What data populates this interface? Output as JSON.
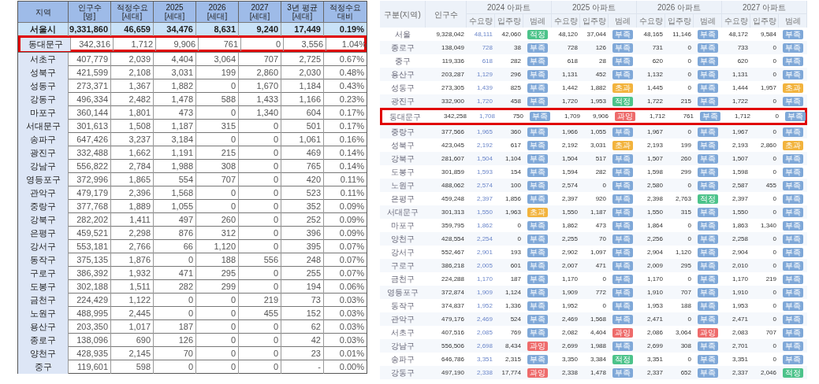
{
  "left_table": {
    "columns": [
      {
        "title": "지역"
      },
      {
        "title": "인구수",
        "unit": "[명]"
      },
      {
        "title": "적정수요",
        "unit": "[세대]"
      },
      {
        "title": "2025",
        "unit": "[세대]"
      },
      {
        "title": "2026",
        "unit": "[세대]"
      },
      {
        "title": "2027",
        "unit": "[세대]"
      },
      {
        "title": "3년 평균",
        "unit": "[세대]"
      },
      {
        "title": "적정수요",
        "unit": "대비"
      }
    ],
    "rows": [
      {
        "kind": "total",
        "highlighted": false,
        "cells": [
          "서울시",
          "9,331,860",
          "46,659",
          "34,476",
          "8,631",
          "9,240",
          "17,449",
          "0.19%"
        ]
      },
      {
        "kind": "district",
        "highlighted": true,
        "cells": [
          "동대문구",
          "342,316",
          "1,712",
          "9,906",
          "761",
          "0",
          "3,556",
          "1.04%"
        ]
      },
      {
        "kind": "district",
        "highlighted": false,
        "cells": [
          "서초구",
          "407,779",
          "2,039",
          "4,404",
          "3,064",
          "707",
          "2,725",
          "0.67%"
        ]
      },
      {
        "kind": "district",
        "highlighted": false,
        "cells": [
          "성북구",
          "421,599",
          "2,108",
          "3,031",
          "199",
          "2,860",
          "2,030",
          "0.48%"
        ]
      },
      {
        "kind": "district",
        "highlighted": false,
        "cells": [
          "성동구",
          "273,371",
          "1,367",
          "1,882",
          "0",
          "1,670",
          "1,184",
          "0.43%"
        ]
      },
      {
        "kind": "district",
        "highlighted": false,
        "cells": [
          "강동구",
          "496,334",
          "2,482",
          "1,478",
          "588",
          "1,433",
          "1,166",
          "0.23%"
        ]
      },
      {
        "kind": "district",
        "highlighted": false,
        "cells": [
          "마포구",
          "360,144",
          "1,801",
          "473",
          "0",
          "1,340",
          "604",
          "0.17%"
        ]
      },
      {
        "kind": "district",
        "highlighted": false,
        "cells": [
          "서대문구",
          "301,613",
          "1,508",
          "1,187",
          "315",
          "0",
          "501",
          "0.17%"
        ]
      },
      {
        "kind": "district",
        "highlighted": false,
        "cells": [
          "송파구",
          "647,426",
          "3,237",
          "3,184",
          "0",
          "0",
          "1,061",
          "0.16%"
        ]
      },
      {
        "kind": "district",
        "highlighted": false,
        "cells": [
          "광진구",
          "332,488",
          "1,662",
          "1,191",
          "215",
          "0",
          "469",
          "0.14%"
        ]
      },
      {
        "kind": "district",
        "highlighted": false,
        "cells": [
          "강남구",
          "556,822",
          "2,784",
          "1,988",
          "308",
          "0",
          "765",
          "0.14%"
        ]
      },
      {
        "kind": "district",
        "highlighted": false,
        "cells": [
          "영등포구",
          "372,996",
          "1,865",
          "554",
          "707",
          "0",
          "420",
          "0.11%"
        ]
      },
      {
        "kind": "district",
        "highlighted": false,
        "cells": [
          "관악구",
          "479,179",
          "2,396",
          "1,568",
          "0",
          "0",
          "523",
          "0.11%"
        ]
      },
      {
        "kind": "district",
        "highlighted": false,
        "cells": [
          "중랑구",
          "377,768",
          "1,889",
          "1,055",
          "0",
          "0",
          "352",
          "0.09%"
        ]
      },
      {
        "kind": "district",
        "highlighted": false,
        "cells": [
          "강북구",
          "282,202",
          "1,411",
          "497",
          "260",
          "0",
          "252",
          "0.09%"
        ]
      },
      {
        "kind": "district",
        "highlighted": false,
        "cells": [
          "은평구",
          "459,521",
          "2,298",
          "876",
          "312",
          "0",
          "396",
          "0.09%"
        ]
      },
      {
        "kind": "district",
        "highlighted": false,
        "cells": [
          "강서구",
          "553,181",
          "2,766",
          "66",
          "1,120",
          "0",
          "395",
          "0.07%"
        ]
      },
      {
        "kind": "district",
        "highlighted": false,
        "cells": [
          "동작구",
          "375,135",
          "1,876",
          "0",
          "188",
          "556",
          "248",
          "0.07%"
        ]
      },
      {
        "kind": "district",
        "highlighted": false,
        "cells": [
          "구로구",
          "386,392",
          "1,932",
          "471",
          "295",
          "0",
          "255",
          "0.07%"
        ]
      },
      {
        "kind": "district",
        "highlighted": false,
        "cells": [
          "도봉구",
          "302,188",
          "1,511",
          "282",
          "299",
          "0",
          "194",
          "0.06%"
        ]
      },
      {
        "kind": "district",
        "highlighted": false,
        "cells": [
          "금천구",
          "224,429",
          "1,122",
          "0",
          "0",
          "219",
          "73",
          "0.03%"
        ]
      },
      {
        "kind": "district",
        "highlighted": false,
        "cells": [
          "노원구",
          "488,995",
          "2,445",
          "0",
          "0",
          "455",
          "152",
          "0.03%"
        ]
      },
      {
        "kind": "district",
        "highlighted": false,
        "cells": [
          "용산구",
          "203,350",
          "1,017",
          "187",
          "0",
          "0",
          "62",
          "0.03%"
        ]
      },
      {
        "kind": "district",
        "highlighted": false,
        "cells": [
          "종로구",
          "138,096",
          "690",
          "126",
          "0",
          "0",
          "42",
          "0.03%"
        ]
      },
      {
        "kind": "district",
        "highlighted": false,
        "cells": [
          "양천구",
          "428,935",
          "2,145",
          "70",
          "0",
          "0",
          "23",
          "0.01%"
        ]
      },
      {
        "kind": "district",
        "highlighted": false,
        "cells": [
          "중구",
          "119,601",
          "598",
          "0",
          "0",
          "0",
          "-",
          "0.00%"
        ]
      }
    ]
  },
  "right_table": {
    "name_header": "구분(지역)",
    "population_header": "인구수",
    "year_groups": [
      {
        "title": "2024 아파트",
        "columns": [
          "수요량",
          "입주량",
          "범례"
        ]
      },
      {
        "title": "2025 아파트",
        "columns": [
          "수요량",
          "입주량",
          "범례"
        ]
      },
      {
        "title": "2026 아파트",
        "columns": [
          "수요량",
          "입주량",
          "범례"
        ]
      },
      {
        "title": "2027 아파트",
        "columns": [
          "수요량",
          "입주량",
          "범례"
        ]
      }
    ],
    "rows": [
      {
        "highlighted": false,
        "name": "서울",
        "population": "9,328,042",
        "years": [
          {
            "demand": "48,111",
            "supply": "42,060",
            "status": "적정",
            "color": "#4cc38a"
          },
          {
            "demand": "48,120",
            "supply": "37,044",
            "status": "부족",
            "color": "#7fa8d8"
          },
          {
            "demand": "48,165",
            "supply": "11,146",
            "status": "부족",
            "color": "#7fa8d8"
          },
          {
            "demand": "48,172",
            "supply": "9,584",
            "status": "부족",
            "color": "#7fa8d8"
          }
        ]
      },
      {
        "highlighted": false,
        "name": "종로구",
        "population": "138,049",
        "years": [
          {
            "demand": "728",
            "supply": "38",
            "status": "부족",
            "color": "#7fa8d8"
          },
          {
            "demand": "728",
            "supply": "126",
            "status": "부족",
            "color": "#7fa8d8"
          },
          {
            "demand": "731",
            "supply": "0",
            "status": "부족",
            "color": "#7fa8d8"
          },
          {
            "demand": "733",
            "supply": "0",
            "status": "부족",
            "color": "#7fa8d8"
          }
        ]
      },
      {
        "highlighted": false,
        "name": "중구",
        "population": "119,336",
        "years": [
          {
            "demand": "618",
            "supply": "282",
            "status": "부족",
            "color": "#7fa8d8"
          },
          {
            "demand": "618",
            "supply": "28",
            "status": "부족",
            "color": "#7fa8d8"
          },
          {
            "demand": "620",
            "supply": "0",
            "status": "부족",
            "color": "#7fa8d8"
          },
          {
            "demand": "620",
            "supply": "0",
            "status": "부족",
            "color": "#7fa8d8"
          }
        ]
      },
      {
        "highlighted": false,
        "name": "용산구",
        "population": "203,287",
        "years": [
          {
            "demand": "1,129",
            "supply": "296",
            "status": "부족",
            "color": "#7fa8d8"
          },
          {
            "demand": "1,131",
            "supply": "452",
            "status": "부족",
            "color": "#7fa8d8"
          },
          {
            "demand": "1,132",
            "supply": "0",
            "status": "부족",
            "color": "#7fa8d8"
          },
          {
            "demand": "1,131",
            "supply": "0",
            "status": "부족",
            "color": "#7fa8d8"
          }
        ]
      },
      {
        "highlighted": false,
        "name": "성동구",
        "population": "273,305",
        "years": [
          {
            "demand": "1,439",
            "supply": "825",
            "status": "부족",
            "color": "#7fa8d8"
          },
          {
            "demand": "1,442",
            "supply": "1,882",
            "status": "초과",
            "color": "#f2b33d"
          },
          {
            "demand": "1,445",
            "supply": "0",
            "status": "부족",
            "color": "#7fa8d8"
          },
          {
            "demand": "1,444",
            "supply": "1,957",
            "status": "초과",
            "color": "#f2b33d"
          }
        ]
      },
      {
        "highlighted": false,
        "name": "광진구",
        "population": "332,900",
        "years": [
          {
            "demand": "1,720",
            "supply": "458",
            "status": "부족",
            "color": "#7fa8d8"
          },
          {
            "demand": "1,720",
            "supply": "1,953",
            "status": "적정",
            "color": "#4cc38a"
          },
          {
            "demand": "1,722",
            "supply": "215",
            "status": "부족",
            "color": "#7fa8d8"
          },
          {
            "demand": "1,722",
            "supply": "0",
            "status": "부족",
            "color": "#7fa8d8"
          }
        ]
      },
      {
        "highlighted": true,
        "name": "동대문구",
        "population": "342,258",
        "years": [
          {
            "demand": "1,708",
            "supply": "750",
            "status": "부족",
            "color": "#7fa8d8"
          },
          {
            "demand": "1,709",
            "supply": "9,906",
            "status": "과잉",
            "color": "#ee6b6b"
          },
          {
            "demand": "1,712",
            "supply": "761",
            "status": "부족",
            "color": "#7fa8d8"
          },
          {
            "demand": "1,712",
            "supply": "0",
            "status": "부족",
            "color": "#7fa8d8"
          }
        ]
      },
      {
        "highlighted": false,
        "name": "중랑구",
        "population": "377,566",
        "years": [
          {
            "demand": "1,965",
            "supply": "360",
            "status": "부족",
            "color": "#7fa8d8"
          },
          {
            "demand": "1,966",
            "supply": "1,055",
            "status": "부족",
            "color": "#7fa8d8"
          },
          {
            "demand": "1,967",
            "supply": "0",
            "status": "부족",
            "color": "#7fa8d8"
          },
          {
            "demand": "1,967",
            "supply": "0",
            "status": "부족",
            "color": "#7fa8d8"
          }
        ]
      },
      {
        "highlighted": false,
        "name": "성북구",
        "population": "423,045",
        "years": [
          {
            "demand": "2,192",
            "supply": "617",
            "status": "부족",
            "color": "#7fa8d8"
          },
          {
            "demand": "2,192",
            "supply": "3,031",
            "status": "초과",
            "color": "#f2b33d"
          },
          {
            "demand": "2,193",
            "supply": "199",
            "status": "부족",
            "color": "#7fa8d8"
          },
          {
            "demand": "2,193",
            "supply": "2,860",
            "status": "초과",
            "color": "#f2b33d"
          }
        ]
      },
      {
        "highlighted": false,
        "name": "강북구",
        "population": "281,607",
        "years": [
          {
            "demand": "1,504",
            "supply": "1,104",
            "status": "부족",
            "color": "#7fa8d8"
          },
          {
            "demand": "1,504",
            "supply": "517",
            "status": "부족",
            "color": "#7fa8d8"
          },
          {
            "demand": "1,507",
            "supply": "260",
            "status": "부족",
            "color": "#7fa8d8"
          },
          {
            "demand": "1,507",
            "supply": "0",
            "status": "부족",
            "color": "#7fa8d8"
          }
        ]
      },
      {
        "highlighted": false,
        "name": "도봉구",
        "population": "301,859",
        "years": [
          {
            "demand": "1,593",
            "supply": "154",
            "status": "부족",
            "color": "#7fa8d8"
          },
          {
            "demand": "1,594",
            "supply": "282",
            "status": "부족",
            "color": "#7fa8d8"
          },
          {
            "demand": "1,598",
            "supply": "299",
            "status": "부족",
            "color": "#7fa8d8"
          },
          {
            "demand": "1,598",
            "supply": "0",
            "status": "부족",
            "color": "#7fa8d8"
          }
        ]
      },
      {
        "highlighted": false,
        "name": "노원구",
        "population": "488,062",
        "years": [
          {
            "demand": "2,574",
            "supply": "100",
            "status": "부족",
            "color": "#7fa8d8"
          },
          {
            "demand": "2,574",
            "supply": "0",
            "status": "부족",
            "color": "#7fa8d8"
          },
          {
            "demand": "2,580",
            "supply": "0",
            "status": "부족",
            "color": "#7fa8d8"
          },
          {
            "demand": "2,587",
            "supply": "455",
            "status": "부족",
            "color": "#7fa8d8"
          }
        ]
      },
      {
        "highlighted": false,
        "name": "은평구",
        "population": "459,248",
        "years": [
          {
            "demand": "2,397",
            "supply": "1,856",
            "status": "부족",
            "color": "#7fa8d8"
          },
          {
            "demand": "2,397",
            "supply": "920",
            "status": "부족",
            "color": "#7fa8d8"
          },
          {
            "demand": "2,398",
            "supply": "2,763",
            "status": "적정",
            "color": "#4cc38a"
          },
          {
            "demand": "2,397",
            "supply": "0",
            "status": "부족",
            "color": "#7fa8d8"
          }
        ]
      },
      {
        "highlighted": false,
        "name": "서대문구",
        "population": "301,313",
        "years": [
          {
            "demand": "1,550",
            "supply": "1,963",
            "status": "초과",
            "color": "#f2b33d"
          },
          {
            "demand": "1,550",
            "supply": "1,187",
            "status": "부족",
            "color": "#7fa8d8"
          },
          {
            "demand": "1,550",
            "supply": "315",
            "status": "부족",
            "color": "#7fa8d8"
          },
          {
            "demand": "1,550",
            "supply": "0",
            "status": "부족",
            "color": "#7fa8d8"
          }
        ]
      },
      {
        "highlighted": false,
        "name": "마포구",
        "population": "359,795",
        "years": [
          {
            "demand": "1,862",
            "supply": "0",
            "status": "부족",
            "color": "#7fa8d8"
          },
          {
            "demand": "1,862",
            "supply": "473",
            "status": "부족",
            "color": "#7fa8d8"
          },
          {
            "demand": "1,864",
            "supply": "0",
            "status": "부족",
            "color": "#7fa8d8"
          },
          {
            "demand": "1,863",
            "supply": "1,340",
            "status": "부족",
            "color": "#7fa8d8"
          }
        ]
      },
      {
        "highlighted": false,
        "name": "양천구",
        "population": "428,554",
        "years": [
          {
            "demand": "2,254",
            "supply": "0",
            "status": "부족",
            "color": "#7fa8d8"
          },
          {
            "demand": "2,255",
            "supply": "70",
            "status": "부족",
            "color": "#7fa8d8"
          },
          {
            "demand": "2,256",
            "supply": "0",
            "status": "부족",
            "color": "#7fa8d8"
          },
          {
            "demand": "2,258",
            "supply": "0",
            "status": "부족",
            "color": "#7fa8d8"
          }
        ]
      },
      {
        "highlighted": false,
        "name": "강서구",
        "population": "552,467",
        "years": [
          {
            "demand": "2,901",
            "supply": "193",
            "status": "부족",
            "color": "#7fa8d8"
          },
          {
            "demand": "2,902",
            "supply": "1,097",
            "status": "부족",
            "color": "#7fa8d8"
          },
          {
            "demand": "2,904",
            "supply": "1,120",
            "status": "부족",
            "color": "#7fa8d8"
          },
          {
            "demand": "2,904",
            "supply": "0",
            "status": "부족",
            "color": "#7fa8d8"
          }
        ]
      },
      {
        "highlighted": false,
        "name": "구로구",
        "population": "386,218",
        "years": [
          {
            "demand": "2,005",
            "supply": "601",
            "status": "부족",
            "color": "#7fa8d8"
          },
          {
            "demand": "2,007",
            "supply": "471",
            "status": "부족",
            "color": "#7fa8d8"
          },
          {
            "demand": "2,009",
            "supply": "295",
            "status": "부족",
            "color": "#7fa8d8"
          },
          {
            "demand": "2,010",
            "supply": "0",
            "status": "부족",
            "color": "#7fa8d8"
          }
        ]
      },
      {
        "highlighted": false,
        "name": "금천구",
        "population": "224,288",
        "years": [
          {
            "demand": "1,170",
            "supply": "187",
            "status": "부족",
            "color": "#7fa8d8"
          },
          {
            "demand": "1,170",
            "supply": "0",
            "status": "부족",
            "color": "#7fa8d8"
          },
          {
            "demand": "1,170",
            "supply": "0",
            "status": "부족",
            "color": "#7fa8d8"
          },
          {
            "demand": "1,170",
            "supply": "219",
            "status": "부족",
            "color": "#7fa8d8"
          }
        ]
      },
      {
        "highlighted": false,
        "name": "영등포구",
        "population": "372,874",
        "years": [
          {
            "demand": "1,909",
            "supply": "1,124",
            "status": "부족",
            "color": "#7fa8d8"
          },
          {
            "demand": "1,909",
            "supply": "772",
            "status": "부족",
            "color": "#7fa8d8"
          },
          {
            "demand": "1,910",
            "supply": "707",
            "status": "부족",
            "color": "#7fa8d8"
          },
          {
            "demand": "1,910",
            "supply": "0",
            "status": "부족",
            "color": "#7fa8d8"
          }
        ]
      },
      {
        "highlighted": false,
        "name": "동작구",
        "population": "374,837",
        "years": [
          {
            "demand": "1,952",
            "supply": "1,336",
            "status": "부족",
            "color": "#7fa8d8"
          },
          {
            "demand": "1,952",
            "supply": "0",
            "status": "부족",
            "color": "#7fa8d8"
          },
          {
            "demand": "1,953",
            "supply": "188",
            "status": "부족",
            "color": "#7fa8d8"
          },
          {
            "demand": "1,953",
            "supply": "0",
            "status": "부족",
            "color": "#7fa8d8"
          }
        ]
      },
      {
        "highlighted": false,
        "name": "관악구",
        "population": "479,176",
        "years": [
          {
            "demand": "2,469",
            "supply": "524",
            "status": "부족",
            "color": "#7fa8d8"
          },
          {
            "demand": "2,469",
            "supply": "1,568",
            "status": "부족",
            "color": "#7fa8d8"
          },
          {
            "demand": "2,471",
            "supply": "0",
            "status": "부족",
            "color": "#7fa8d8"
          },
          {
            "demand": "2,471",
            "supply": "0",
            "status": "부족",
            "color": "#7fa8d8"
          }
        ]
      },
      {
        "highlighted": false,
        "name": "서초구",
        "population": "407,516",
        "years": [
          {
            "demand": "2,085",
            "supply": "769",
            "status": "부족",
            "color": "#7fa8d8"
          },
          {
            "demand": "2,082",
            "supply": "4,404",
            "status": "과잉",
            "color": "#ee6b6b"
          },
          {
            "demand": "2,086",
            "supply": "3,064",
            "status": "과잉",
            "color": "#ee6b6b"
          },
          {
            "demand": "2,083",
            "supply": "707",
            "status": "부족",
            "color": "#7fa8d8"
          }
        ]
      },
      {
        "highlighted": false,
        "name": "강남구",
        "population": "556,506",
        "years": [
          {
            "demand": "2,698",
            "supply": "8,434",
            "status": "과잉",
            "color": "#ee6b6b"
          },
          {
            "demand": "2,699",
            "supply": "1,988",
            "status": "부족",
            "color": "#7fa8d8"
          },
          {
            "demand": "2,699",
            "supply": "308",
            "status": "부족",
            "color": "#7fa8d8"
          },
          {
            "demand": "2,701",
            "supply": "0",
            "status": "부족",
            "color": "#7fa8d8"
          }
        ]
      },
      {
        "highlighted": false,
        "name": "송파구",
        "population": "646,786",
        "years": [
          {
            "demand": "3,351",
            "supply": "2,315",
            "status": "부족",
            "color": "#7fa8d8"
          },
          {
            "demand": "3,350",
            "supply": "3,384",
            "status": "적정",
            "color": "#4cc38a"
          },
          {
            "demand": "3,351",
            "supply": "0",
            "status": "부족",
            "color": "#7fa8d8"
          },
          {
            "demand": "3,351",
            "supply": "0",
            "status": "부족",
            "color": "#7fa8d8"
          }
        ]
      },
      {
        "highlighted": false,
        "name": "강동구",
        "population": "497,190",
        "years": [
          {
            "demand": "2,338",
            "supply": "17,774",
            "status": "과잉",
            "color": "#ee6b6b"
          },
          {
            "demand": "2,338",
            "supply": "1,478",
            "status": "부족",
            "color": "#7fa8d8"
          },
          {
            "demand": "2,337",
            "supply": "652",
            "status": "부족",
            "color": "#7fa8d8"
          },
          {
            "demand": "2,337",
            "supply": "2,046",
            "status": "적정",
            "color": "#4cc38a"
          }
        ]
      }
    ]
  }
}
